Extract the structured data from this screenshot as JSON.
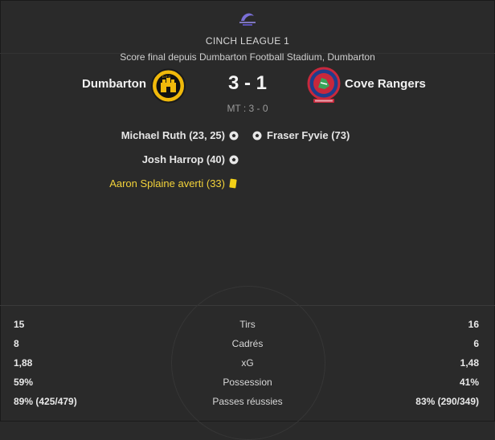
{
  "competition": {
    "name": "CINCH LEAGUE 1"
  },
  "match": {
    "subtitle": "Score final depuis Dumbarton Football Stadium, Dumbarton",
    "home": {
      "name": "Dumbarton"
    },
    "away": {
      "name": "Cove Rangers"
    },
    "score": "3 - 1",
    "half_time": "MT : 3 - 0"
  },
  "events": {
    "home": [
      {
        "text": "Michael Ruth (23, 25)",
        "icon": "football-icon"
      },
      {
        "text": "Josh Harrop (40)",
        "icon": "football-icon"
      },
      {
        "text": "Aaron Splaine averti (33)",
        "icon": "yellow-card-icon"
      }
    ],
    "away": [
      {
        "text": "Fraser Fyvie (73)",
        "icon": "football-icon"
      }
    ]
  },
  "stats": [
    {
      "label": "Tirs",
      "home": "15",
      "away": "16"
    },
    {
      "label": "Cadrés",
      "home": "8",
      "away": "6"
    },
    {
      "label": "xG",
      "home": "1,88",
      "away": "1,48"
    },
    {
      "label": "Possession",
      "home": "59%",
      "away": "41%"
    },
    {
      "label": "Passes réussies",
      "home": "89% (425/479)",
      "away": "83% (290/349)"
    }
  ],
  "colors": {
    "background": "#2a2a2a",
    "yellow_card": "#f2d017",
    "card_text": "#f2d23a",
    "home_crest": "#f0b90b",
    "away_crest": "#c8283c"
  }
}
